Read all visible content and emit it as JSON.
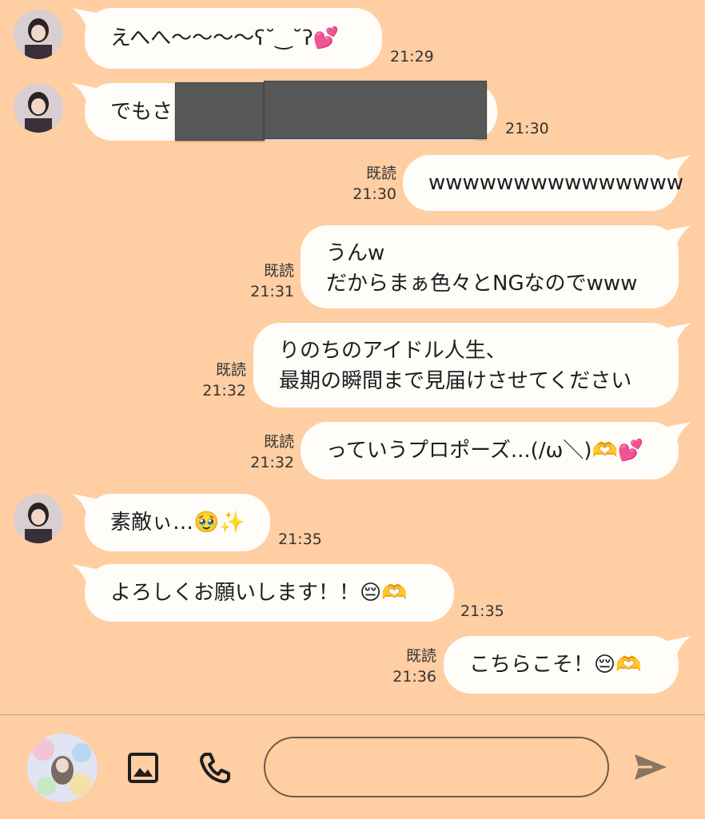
{
  "messages": [
    {
      "text": "えへへ〜〜〜〜ʕ˘‿˘ʔ💕",
      "time": "21:29"
    },
    {
      "text": "でもさ",
      "time": "21:30"
    },
    {
      "text": "wwwwwwwwwwwwwww",
      "read": "既読",
      "time": "21:30"
    },
    {
      "lines": [
        "うんw",
        "だからまぁ色々とNGなのでwww"
      ],
      "read": "既読",
      "time": "21:31"
    },
    {
      "lines": [
        "りのちのアイドル人生、",
        "最期の瞬間まで見届けさせてください"
      ],
      "read": "既読",
      "time": "21:32"
    },
    {
      "text": "っていうプロポーズ...(/ω＼)🫶💕",
      "read": "既読",
      "time": "21:32"
    },
    {
      "text": "素敵ぃ…🥹✨",
      "time": "21:35"
    },
    {
      "text": "よろしくお願いします！！😔🫶",
      "time": "21:35"
    },
    {
      "text": "こちらこそ！😔🫶",
      "read": "既読",
      "time": "21:36"
    }
  ],
  "composer": {
    "input_placeholder": "",
    "image_icon": "image-icon",
    "phone_icon": "phone-icon",
    "send_icon": "send-icon"
  },
  "colors": {
    "background": "#ffcfa3",
    "bubble": "#fffdfa"
  }
}
